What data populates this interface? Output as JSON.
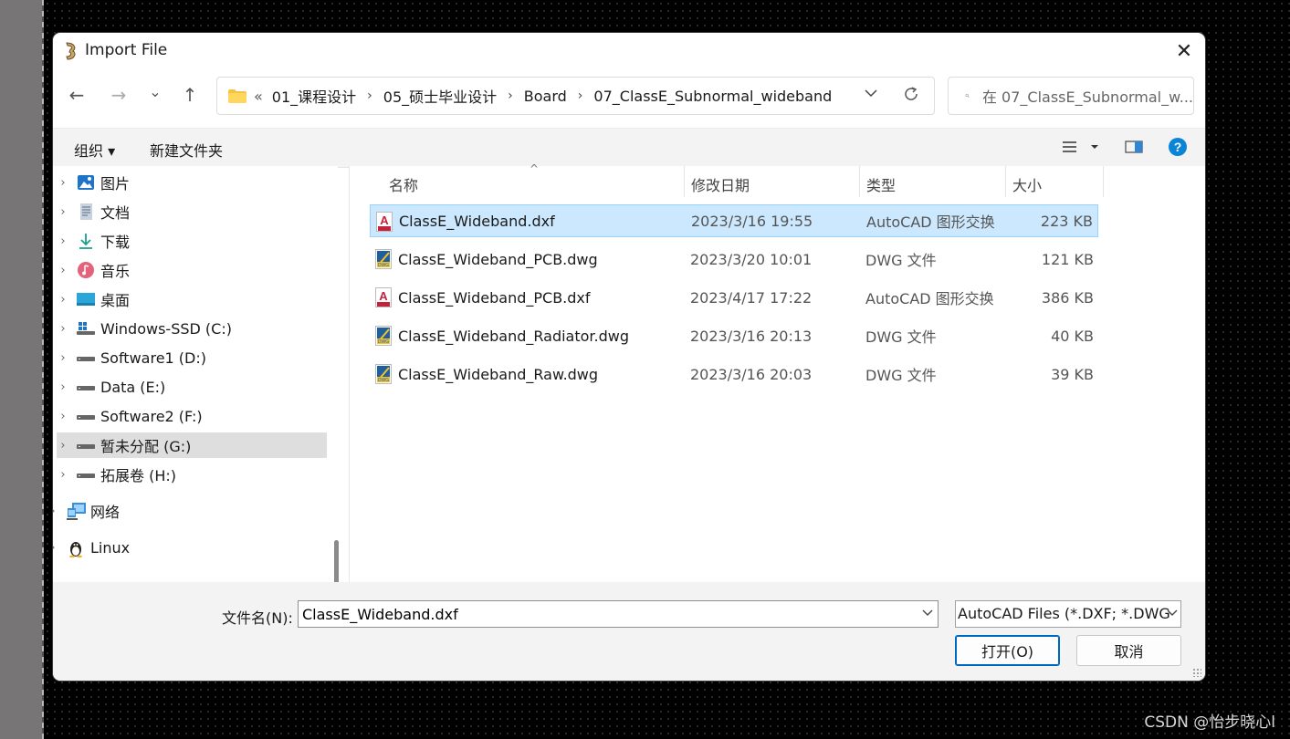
{
  "window": {
    "title": "Import File",
    "close_glyph": "✕"
  },
  "nav_buttons": {
    "back": "←",
    "forward": "→",
    "history": "⌄",
    "up": "↑"
  },
  "address": {
    "overflow": "«",
    "parts": [
      "01_课程设计",
      "05_硕士毕业设计",
      "Board",
      "07_ClassE_Subnormal_wideband"
    ],
    "separator": "›"
  },
  "search": {
    "placeholder": "在 07_ClassE_Subnormal_w..."
  },
  "toolbar": {
    "organize": "组织 ▾",
    "new_folder": "新建文件夹"
  },
  "sidebar": {
    "items": [
      {
        "label": "图片",
        "icon": "pictures-icon"
      },
      {
        "label": "文档",
        "icon": "documents-icon"
      },
      {
        "label": "下载",
        "icon": "downloads-icon"
      },
      {
        "label": "音乐",
        "icon": "music-icon"
      },
      {
        "label": "桌面",
        "icon": "desktop-icon"
      },
      {
        "label": "Windows-SSD (C:)",
        "icon": "windows-drive-icon"
      },
      {
        "label": "Software1 (D:)",
        "icon": "drive-icon"
      },
      {
        "label": "Data (E:)",
        "icon": "drive-icon"
      },
      {
        "label": "Software2 (F:)",
        "icon": "drive-icon"
      },
      {
        "label": "暂未分配 (G:)",
        "icon": "drive-icon",
        "selected": true
      },
      {
        "label": "拓展卷 (H:)",
        "icon": "drive-icon"
      },
      {
        "label": "网络",
        "icon": "network-icon"
      },
      {
        "label": "Linux",
        "icon": "linux-penguin-icon"
      }
    ]
  },
  "files": {
    "columns": [
      "名称",
      "修改日期",
      "类型",
      "大小"
    ],
    "rows": [
      {
        "name": "ClassE_Wideband.dxf",
        "date": "2023/3/16 19:55",
        "type": "AutoCAD 图形交换",
        "size": "223 KB",
        "icon": "dxf",
        "selected": true
      },
      {
        "name": "ClassE_Wideband_PCB.dwg",
        "date": "2023/3/20 10:01",
        "type": "DWG 文件",
        "size": "121 KB",
        "icon": "dwg"
      },
      {
        "name": "ClassE_Wideband_PCB.dxf",
        "date": "2023/4/17 17:22",
        "type": "AutoCAD 图形交换",
        "size": "386 KB",
        "icon": "dxf"
      },
      {
        "name": "ClassE_Wideband_Radiator.dwg",
        "date": "2023/3/16 20:13",
        "type": "DWG 文件",
        "size": "40 KB",
        "icon": "dwg"
      },
      {
        "name": "ClassE_Wideband_Raw.dwg",
        "date": "2023/3/16 20:03",
        "type": "DWG 文件",
        "size": "39 KB",
        "icon": "dwg"
      }
    ]
  },
  "bottom": {
    "filename_label": "文件名(N):",
    "filename_value": "ClassE_Wideband.dxf",
    "filetype": "AutoCAD Files (*.DXF; *.DWG",
    "open": "打开(O)",
    "cancel": "取消"
  },
  "watermark": "CSDN @怡步晓心l",
  "colors": {
    "selection_bg": "#cce8ff",
    "selection_border": "#99d1ff",
    "accent": "#0067c0",
    "help": "#0a84d6"
  }
}
